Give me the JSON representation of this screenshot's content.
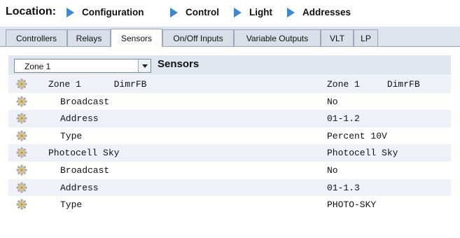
{
  "breadcrumb": {
    "label": "Location:",
    "items": [
      "Configuration",
      "Control",
      "Light",
      "Addresses"
    ]
  },
  "tabs": [
    {
      "label": "Controllers",
      "active": false
    },
    {
      "label": "Relays",
      "active": false
    },
    {
      "label": "Sensors",
      "active": true
    },
    {
      "label": "On/Off Inputs",
      "active": false
    },
    {
      "label": "Variable Outputs",
      "active": false
    },
    {
      "label": "VLT",
      "active": false
    },
    {
      "label": "LP",
      "active": false
    }
  ],
  "toolbar": {
    "zone_select": "Zone 1",
    "title": "Sensors"
  },
  "rows": [
    {
      "name": "Zone 1      DimrFB",
      "value": "Zone 1     DimrFB",
      "indent": false,
      "icon": "gear-icon"
    },
    {
      "name": "Broadcast",
      "value": "No",
      "indent": true,
      "icon": "gear-icon"
    },
    {
      "name": "Address",
      "value": "01-1.2",
      "indent": true,
      "icon": "gear-icon"
    },
    {
      "name": "Type",
      "value": "Percent 10V",
      "indent": true,
      "icon": "gear-icon"
    },
    {
      "name": "Photocell Sky",
      "value": "Photocell Sky",
      "indent": false,
      "icon": "gear-icon"
    },
    {
      "name": "Broadcast",
      "value": "No",
      "indent": true,
      "icon": "gear-icon"
    },
    {
      "name": "Address",
      "value": "01-1.3",
      "indent": true,
      "icon": "gear-icon"
    },
    {
      "name": "Type",
      "value": "PHOTO-SKY",
      "indent": true,
      "icon": "gear-icon"
    }
  ],
  "colors": {
    "breadcrumb_arrow": "#3b87d8",
    "tab_strip": "#dde4ee",
    "row_alt": "#eef2f8"
  }
}
